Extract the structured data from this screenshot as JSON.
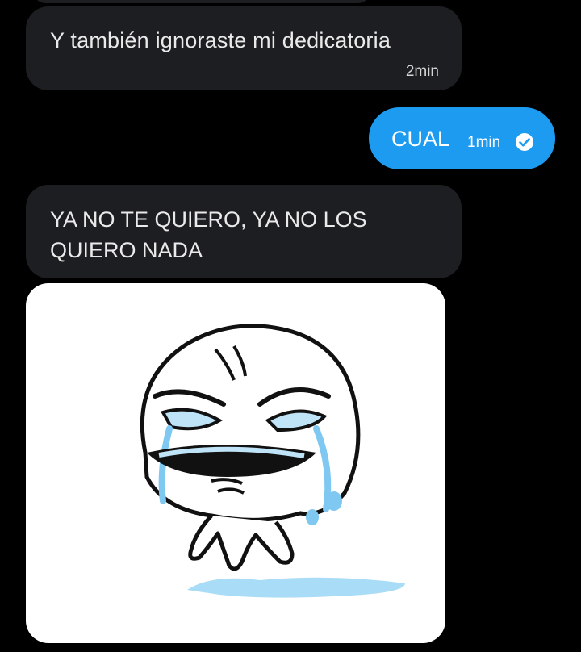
{
  "conversation": {
    "messages": [
      {
        "direction": "received",
        "text": "Y también ignoraste mi dedicatoria",
        "time": "2min"
      },
      {
        "direction": "sent",
        "text": "CUAL",
        "time": "1min",
        "status_icon": "seen-check-icon"
      },
      {
        "direction": "received",
        "text": "YA NO TE QUIERO, YA NO LOS QUIERO NADA"
      },
      {
        "direction": "received",
        "type": "image",
        "image_icon": "crying-meme-face-sticker"
      }
    ]
  },
  "colors": {
    "background": "#000000",
    "received_bubble": "#1d1e21",
    "sent_bubble": "#1d9bf0",
    "text": "#eaeaea",
    "tear_blue": "#7ec8f2"
  }
}
